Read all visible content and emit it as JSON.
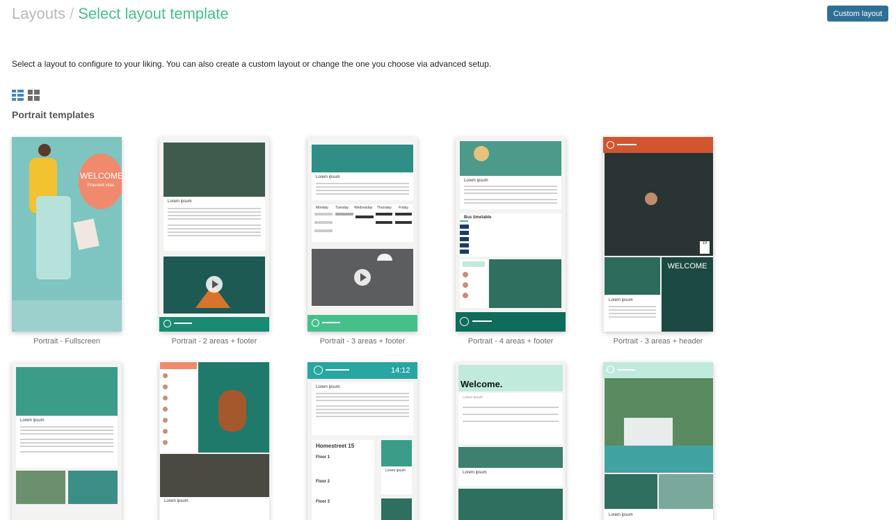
{
  "breadcrumb": {
    "root": "Layouts",
    "separator": "/",
    "current": "Select layout template"
  },
  "header": {
    "custom_button": "Custom layout"
  },
  "description": "Select a layout to configure to your liking. You can also create a custom layout or change the one you choose via advanced setup.",
  "section_title": "Portrait templates",
  "templates": [
    {
      "caption": "Portrait - Fullscreen"
    },
    {
      "caption": "Portrait - 2 areas + footer"
    },
    {
      "caption": "Portrait - 3 areas + footer"
    },
    {
      "caption": "Portrait - 4 areas + footer"
    },
    {
      "caption": "Portrait - 3 areas + header"
    }
  ],
  "preview_text": {
    "welcome": "WELCOME!",
    "welcome_sub": "Praesent vitae",
    "lorem": "Lorem ipsum",
    "days": [
      "Monday",
      "Tuesday",
      "Wednesday",
      "Thursday",
      "Friday"
    ],
    "bus": "Bus timetable",
    "welcome_caps": "WELCOME",
    "welcome_dot": "Welcome.",
    "homestreet": "Homestreet 15",
    "floors": [
      "Floor 1",
      "Floor 2",
      "Floor 3"
    ],
    "time": "14:12",
    "date_day": "19"
  },
  "colors": {
    "accent_green": "#46c08a",
    "button_blue": "#2f6f96",
    "teal_footer": "#1b8a72",
    "dark_teal": "#0f6b5a",
    "orange": "#d2552f",
    "salmon": "#f08a6d",
    "mint": "#bfeadc"
  }
}
